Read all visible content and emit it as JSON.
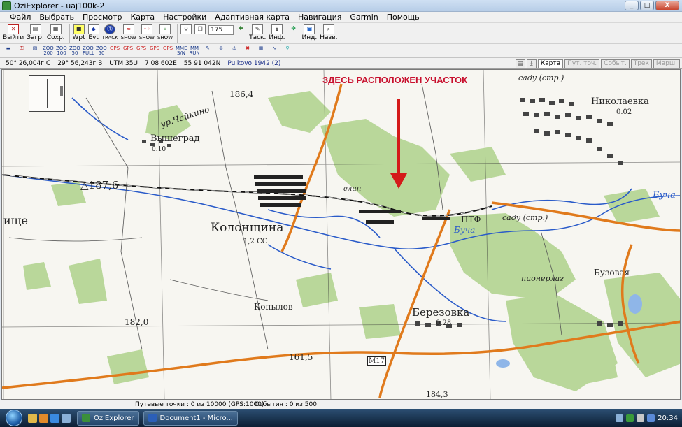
{
  "window": {
    "title": "OziExplorer - uaj100k-2",
    "controls": [
      "_",
      "□",
      "X"
    ]
  },
  "menu": [
    "Файл",
    "Выбрать",
    "Просмотр",
    "Карта",
    "Настройки",
    "Адаптивная карта",
    "Навигация",
    "Garmin",
    "Помощь"
  ],
  "toolbar1": {
    "exit": "Выйти",
    "load": "Загр.",
    "save": "Сохр.",
    "wpt": "Wpt",
    "evt": "Evt",
    "zoom_value": "175",
    "task": "Таск.",
    "info": "Инф.",
    "ind": "Инд.",
    "names": "Назв.",
    "track_lbl": "TRACK",
    "show_lbl": "SHOW"
  },
  "toolbar2": [
    "ZOOM 200",
    "ZOOM 100",
    "ZOOM 50",
    "ZOOM FULL",
    "ZOOM 50",
    "GPS",
    "GPS",
    "GPS",
    "GPS",
    "GPS",
    "MMEM S/N",
    "MM RUN"
  ],
  "status": {
    "lat": "50° 26,004г С",
    "lon": "29° 56,243г В",
    "grid": "UTM  35U",
    "easting": "7 08 602E",
    "northing": "55 91 042N",
    "datum": "Pulkovo 1942 (2)",
    "tabs": [
      "Карта",
      "Пут. точ.",
      "Событ.",
      "Трек",
      "Марш."
    ]
  },
  "map": {
    "annotation": "ЗДЕСЬ РАСПОЛОЖЕН УЧАСТОК",
    "labels": {
      "kolonshchina": "Колонщина",
      "kolonshchina_sub": "1,2 СС",
      "vyshegrad": "Вышеград",
      "vyshegrad_sub": "0.10",
      "chaikino": "ур.Чайкино",
      "elev186": "186,4",
      "elev187": "△187,6",
      "shche": "ище",
      "elev182": "182,0",
      "kopylov": "Копылов",
      "berezovka": "Березовка",
      "berezovka_sub": "0.28",
      "nikolaevka": "Николаевка",
      "nikolaevka_sub": "0.02",
      "sadu": "саду (стр.)",
      "ptf": "ПТФ",
      "bucha": "Буча",
      "buzovaya": "Бузовая",
      "pionerlag": "пионерлаг",
      "elev161": "161,5",
      "m17": "М17",
      "elev184": "184,3",
      "elin": "елин"
    }
  },
  "bottom": {
    "waypoints": "Путевые точки : 0 из 10000  (GPS:1000)",
    "events": "События : 0 из 500"
  },
  "taskbar": {
    "apps": [
      "OziExplorer",
      "Document1 - Micro..."
    ],
    "clock": "20:34"
  }
}
